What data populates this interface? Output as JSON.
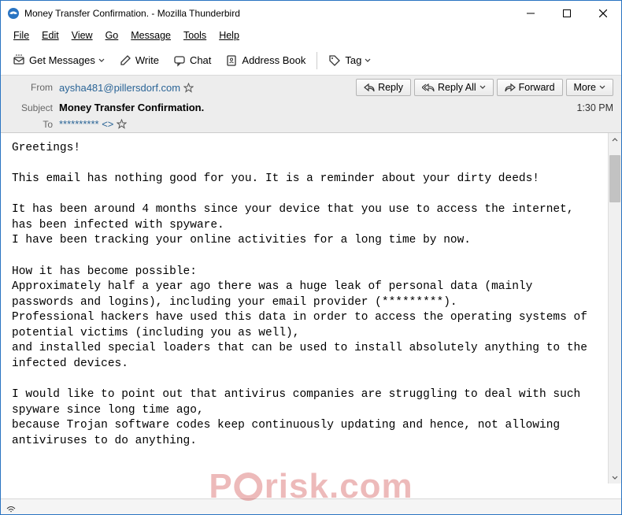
{
  "window": {
    "title": "Money Transfer Confirmation. - Mozilla Thunderbird"
  },
  "menu": {
    "file": "File",
    "edit": "Edit",
    "view": "View",
    "go": "Go",
    "message": "Message",
    "tools": "Tools",
    "help": "Help"
  },
  "toolbar": {
    "get_messages": "Get Messages",
    "write": "Write",
    "chat": "Chat",
    "address_book": "Address Book",
    "tag": "Tag"
  },
  "header": {
    "from_label": "From",
    "from_value": "aysha481@pillersdorf.com",
    "subject_label": "Subject",
    "subject_value": "Money Transfer Confirmation.",
    "to_label": "To",
    "to_value": "********** <>",
    "time": "1:30 PM"
  },
  "actions": {
    "reply": "Reply",
    "reply_all": "Reply All",
    "forward": "Forward",
    "more": "More"
  },
  "body_text": "Greetings!\n\nThis email has nothing good for you. It is a reminder about your dirty deeds!\n\nIt has been around 4 months since your device that you use to access the internet, has been infected with spyware.\nI have been tracking your online activities for a long time by now.\n\nHow it has become possible:\nApproximately half a year ago there was a huge leak of personal data (mainly passwords and logins), including your email provider (*********).\nProfessional hackers have used this data in order to access the operating systems of potential victims (including you as well),\nand installed special loaders that can be used to install absolutely anything to the infected devices.\n\nI would like to point out that antivirus companies are struggling to deal with such spyware since long time ago,\nbecause Trojan software codes keep continuously updating and hence, not allowing antiviruses to do anything.",
  "watermark": {
    "text_left": "P",
    "text_right": "risk.com"
  }
}
